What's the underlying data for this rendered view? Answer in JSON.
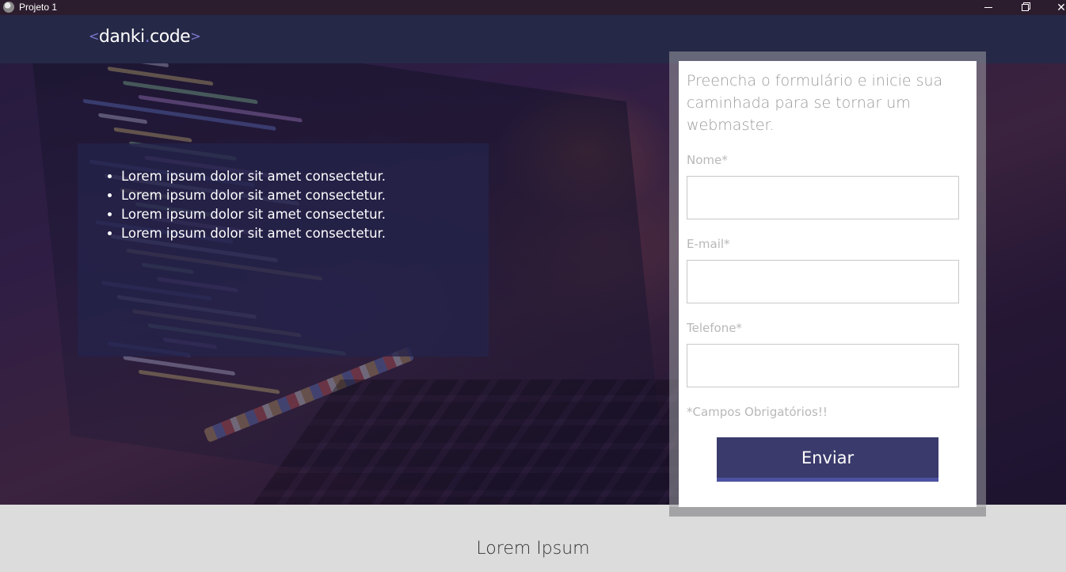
{
  "window": {
    "title": "Projeto 1",
    "app_icon": "globe-icon",
    "close_glyph": "✕"
  },
  "header": {
    "logo_open": "<",
    "logo_text_1": "danki",
    "logo_dot": ".",
    "logo_text_2": "code",
    "logo_close": ">"
  },
  "hero": {
    "bullets": [
      "Lorem ipsum dolor sit amet consectetur.",
      "Lorem ipsum dolor sit amet consectetur.",
      "Lorem ipsum dolor sit amet consectetur.",
      "Lorem ipsum dolor sit amet consectetur."
    ]
  },
  "form": {
    "title": "Preencha o formulário e inicie sua caminhada para se tornar um webmaster.",
    "name_label": "Nome*",
    "name_value": "",
    "email_label": "E-mail*",
    "email_value": "",
    "phone_label": "Telefone*",
    "phone_value": "",
    "required_note": "*Campos Obrigatórios!!",
    "submit_label": "Enviar"
  },
  "section": {
    "title": "Lorem Ipsum"
  },
  "colors": {
    "header_bg": "#262847",
    "button_bg": "#3a3a6c",
    "accent": "#7f78d0"
  }
}
